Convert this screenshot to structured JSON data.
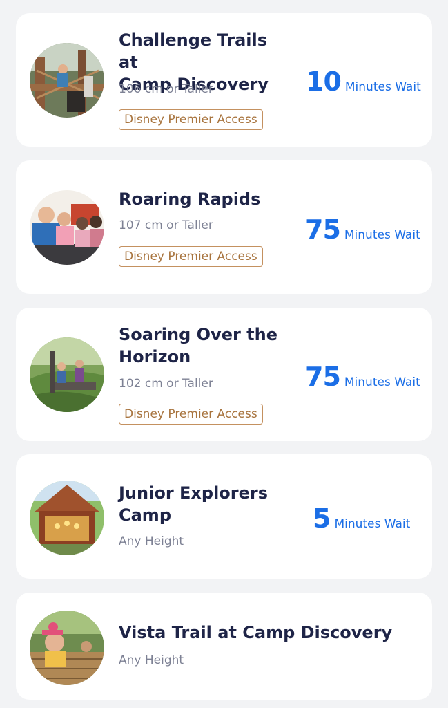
{
  "attractions": [
    {
      "title_line1": "Challenge Trails at",
      "title_line2": "Camp Discovery",
      "height_requirement": "106 cm or Taller",
      "badge": "Disney Premier Access",
      "wait_value": "10",
      "wait_label": "Minutes Wait",
      "image_icon": "challenge-trails-photo"
    },
    {
      "title_line1": "Roaring Rapids",
      "title_line2": "",
      "height_requirement": "107 cm or Taller",
      "badge": "Disney Premier Access",
      "wait_value": "75",
      "wait_label": "Minutes Wait",
      "image_icon": "roaring-rapids-photo"
    },
    {
      "title_line1": "Soaring Over the",
      "title_line2": "Horizon",
      "height_requirement": "102 cm or Taller",
      "badge": "Disney Premier Access",
      "wait_value": "75",
      "wait_label": "Minutes Wait",
      "image_icon": "soaring-photo"
    },
    {
      "title_line1": "Junior Explorers",
      "title_line2": "Camp",
      "height_requirement": "Any Height",
      "badge": "",
      "wait_value": "5",
      "wait_label": "Minutes Wait",
      "image_icon": "junior-explorers-photo"
    },
    {
      "title_line1": "Vista Trail at Camp Discovery",
      "title_line2": "",
      "height_requirement": "Any Height",
      "badge": "",
      "wait_value": "",
      "wait_label": "",
      "image_icon": "vista-trail-photo"
    }
  ],
  "colors": {
    "background": "#f2f3f5",
    "card": "#ffffff",
    "title": "#1e2447",
    "subtext": "#7d8194",
    "premier_access": "#a8743e",
    "wait_accent": "#1b6ee6"
  }
}
